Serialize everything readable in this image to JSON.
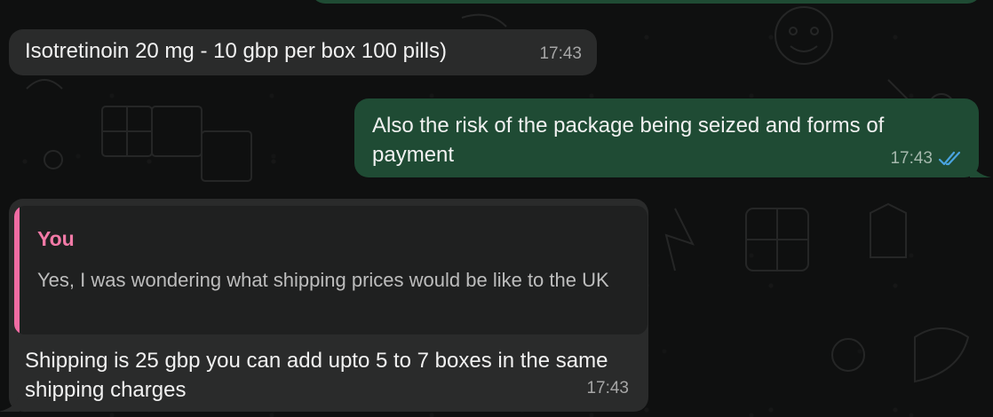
{
  "messages": [
    {
      "id": "msg1",
      "direction": "incoming",
      "text": "Isotretinoin 20 mg - 10 gbp per box 100 pills)",
      "time": "17:43"
    },
    {
      "id": "msg2",
      "direction": "outgoing",
      "text": "Also the risk of the package being seized and forms of payment",
      "time": "17:43",
      "status_icon": "double-check-read-icon"
    },
    {
      "id": "msg3",
      "direction": "incoming",
      "reply": {
        "author": "You",
        "text": "Yes, I was wondering what shipping prices would be like to the UK"
      },
      "text": "Shipping is 25 gbp you can add upto 5 to 7 boxes in the same shipping charges",
      "time": "17:43"
    }
  ],
  "colors": {
    "background": "#0f1010",
    "incoming_bubble": "#2a2b2b",
    "outgoing_bubble": "#1f4b34",
    "quote_bar": "#f06ca3",
    "quote_author": "#f27aa7",
    "read_ticks": "#4aa3df"
  }
}
